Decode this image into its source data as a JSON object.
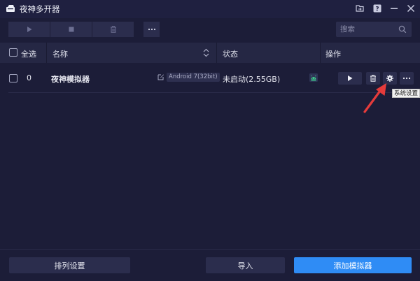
{
  "window": {
    "title": "夜神多开器"
  },
  "toolbar": {
    "search_placeholder": "搜索"
  },
  "table": {
    "headers": {
      "select_all": "全选",
      "name": "名称",
      "status": "状态",
      "actions": "操作"
    },
    "rows": [
      {
        "index": "0",
        "name": "夜神模拟器",
        "android_version": "Android 7(32bit)",
        "status": "未启动(2.55GB)"
      }
    ]
  },
  "tooltip": {
    "settings": "系统设置"
  },
  "footer": {
    "arrange_label": "排列设置",
    "import_label": "导入",
    "add_label": "添加模拟器"
  },
  "colors": {
    "background": "#1c1d38",
    "button": "#2b2d4d",
    "accent": "#2f8cf5",
    "annotation_arrow": "#e53b3b",
    "android": "#3fcf8e"
  },
  "icons": {
    "app": "app-logo-icon",
    "play": "play-icon",
    "stop": "stop-icon",
    "delete": "trash-icon",
    "more": "more-icon",
    "search": "search-icon",
    "sort": "sort-icon",
    "edit": "edit-icon",
    "android": "android-icon",
    "settings": "gear-icon",
    "window_buttons": [
      "folder-icon",
      "help-icon",
      "minimize-icon",
      "close-icon"
    ]
  }
}
